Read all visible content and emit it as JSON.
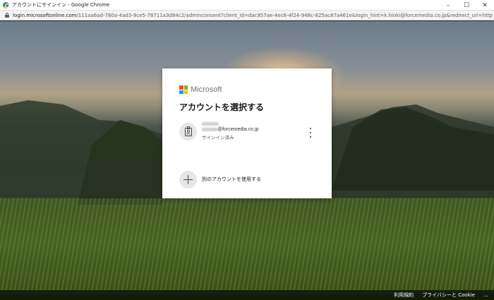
{
  "window": {
    "title": "アカウントにサインイン - Google Chrome",
    "controls": {
      "minimize": "–",
      "maximize": "☐",
      "close": "✕"
    }
  },
  "address_bar": {
    "host": "login.microsoftonline.com",
    "path": "/111aa6ad-780a-4ad3-9ce5-78711a3d84c2/adminconsent?client_id=dac957ae-4ec6-4f24-948c-825ac87a461e&login_hint=k.hioki@forcemedia.co.jp&redirect_uri=https://..."
  },
  "card": {
    "brand": "Microsoft",
    "brand_colors": [
      "#f25022",
      "#7fba00",
      "#00a4ef",
      "#ffb900"
    ],
    "title": "アカウントを選択する",
    "account": {
      "email_domain": "@forcemedia.co.jp",
      "status": "サインイン済み",
      "avatar_icon": "badge-person-icon",
      "menu_icon": "more-vertical-icon"
    },
    "other_account_label": "別のアカウントを使用する"
  },
  "footer": {
    "terms": "利用規約",
    "privacy": "プライバシーと Cookie",
    "more": "…"
  }
}
